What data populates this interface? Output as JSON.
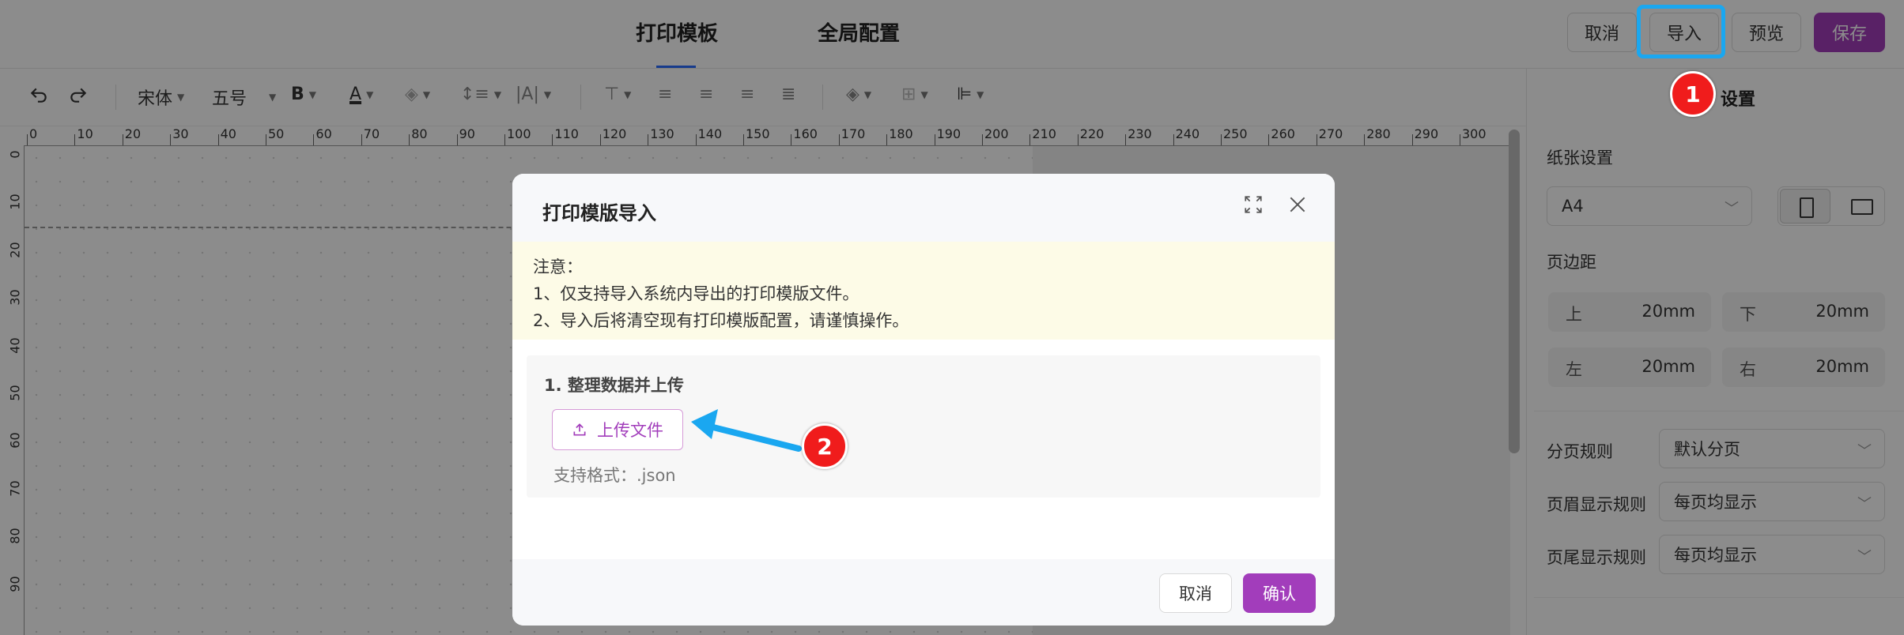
{
  "topbar": {
    "tabs": [
      {
        "label": "打印模板"
      },
      {
        "label": "全局配置"
      }
    ],
    "buttons": {
      "cancel": "取消",
      "import": "导入",
      "preview": "预览",
      "save": "保存"
    }
  },
  "toolbar": {
    "font_family": "宋体",
    "font_size": "五号",
    "bold_label": "B",
    "color_label": "A"
  },
  "ruler": {
    "h_labels": [
      "0",
      "10",
      "20",
      "30",
      "40",
      "50",
      "60",
      "70",
      "80",
      "90",
      "100",
      "110",
      "120",
      "130",
      "140",
      "150",
      "160",
      "170",
      "180",
      "190",
      "200",
      "210",
      "220",
      "230",
      "240",
      "250",
      "260",
      "270",
      "280",
      "290",
      "300"
    ],
    "v_labels": [
      "0",
      "10",
      "20",
      "30",
      "40",
      "50",
      "60",
      "70",
      "80",
      "90"
    ]
  },
  "right_panel": {
    "title": "设置",
    "paper_label": "纸张设置",
    "paper_size": "A4",
    "margin_label": "页边距",
    "margins": [
      {
        "key": "上",
        "value": "20mm"
      },
      {
        "key": "下",
        "value": "20mm"
      },
      {
        "key": "左",
        "value": "20mm"
      },
      {
        "key": "右",
        "value": "20mm"
      }
    ],
    "page_rule_label": "分页规则",
    "page_rule_value": "默认分页",
    "header_rule_label": "页眉显示规则",
    "header_rule_value": "每页均显示",
    "footer_rule_label": "页尾显示规则",
    "footer_rule_value": "每页均显示"
  },
  "dialog": {
    "title": "打印模版导入",
    "notice": [
      "注意：",
      "1、仅支持导入系统内导出的打印模版文件。",
      "2、导入后将清空现有打印模版配置，请谨慎操作。"
    ],
    "step_title": "1. 整理数据并上传",
    "upload_label": "上传文件",
    "hint": "支持格式：.json",
    "cancel": "取消",
    "confirm": "确认"
  },
  "annotations": {
    "marker1": "1",
    "marker2": "2"
  },
  "colors": {
    "accent": "#a23dbb",
    "highlight": "#1aa7f0",
    "marker": "#f01c1c"
  }
}
